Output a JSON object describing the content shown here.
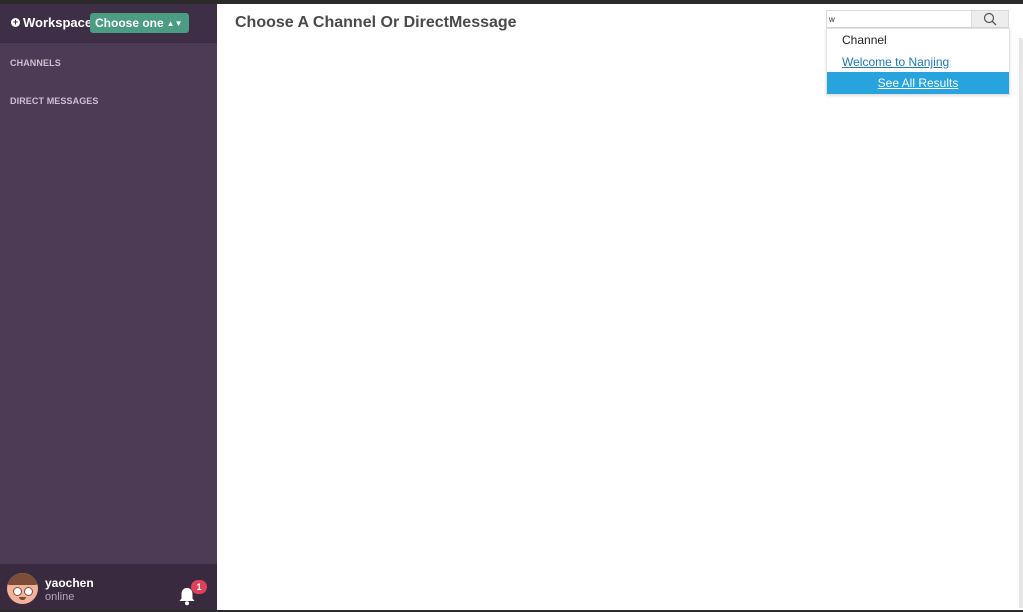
{
  "sidebar": {
    "workspace_label": "Workspace:",
    "workspace_select": "Choose one",
    "channels_label": "CHANNELS",
    "dm_label": "DIRECT MESSAGES",
    "user": {
      "name": "yaochen",
      "status": "online"
    },
    "notification_count": "1"
  },
  "main": {
    "title": "Choose A Channel Or DirectMessage"
  },
  "search": {
    "value": "w",
    "results": {
      "header": "Channel",
      "items": [
        "Welcome to Nanjing"
      ],
      "see_all": "See All Results"
    }
  },
  "colors": {
    "sidebar_bg": "#4d3a55",
    "workspace_select_bg": "#4a9c82",
    "badge_red": "#e0415a",
    "see_all_blue": "#27a3dd",
    "link_blue": "#1f76c1"
  },
  "icons": [
    "plus-circle-icon",
    "select-arrows-icon",
    "user-avatar",
    "bell-icon",
    "search-icon"
  ]
}
